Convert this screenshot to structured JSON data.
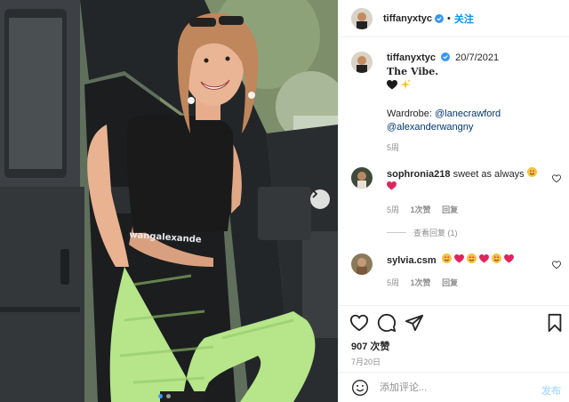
{
  "photo": {
    "shirt_text": "wangalexande"
  },
  "header": {
    "username": "tiffanyxtyc",
    "separator": "•",
    "follow_label": "关注"
  },
  "caption": {
    "username": "tiffanyxtyc",
    "date": "20/7/2021",
    "title": "The Vibe.",
    "wardrobe_prefix": "Wardrobe: ",
    "mention_1": "@lanecrawford",
    "mention_2": "@alexanderwangny",
    "age": "5周"
  },
  "comments": [
    {
      "username": "sophronia218",
      "text": "sweet as always",
      "age": "5周",
      "likes": "1次赞",
      "reply": "回复"
    },
    {
      "username": "sylvia.csm",
      "age": "5周",
      "likes": "1次赞",
      "reply": "回复"
    }
  ],
  "view_replies": "查看回复 (1)",
  "actions": {
    "likes_count": "907 次赞",
    "date": "7月20日"
  },
  "composer": {
    "placeholder": "添加评论...",
    "post_label": "发布"
  },
  "colors": {
    "accent": "#0095f6",
    "post_disabled": "#b2dffc",
    "pants": "#b6e58a"
  }
}
